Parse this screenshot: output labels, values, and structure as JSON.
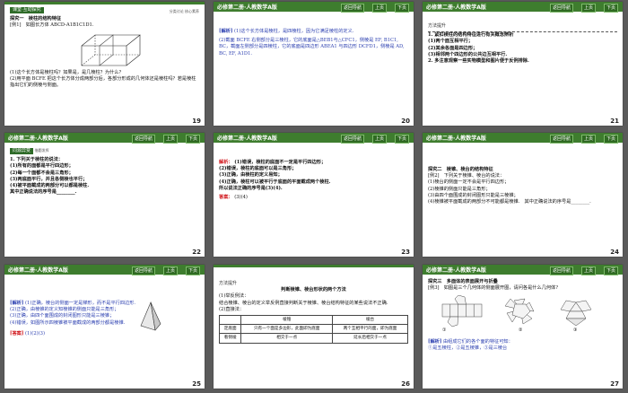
{
  "header": {
    "title": "必修第二册·人教数学A版",
    "nav_label": "返回导航",
    "prev_label": "上页",
    "next_label": "下页"
  },
  "slides": {
    "s19": {
      "page": "19",
      "section": "课堂·互动探究",
      "section_tag": "分类讨论  核心素养",
      "inquiry": "探究一　棱柱的结构特征",
      "example": "[例1]　如图长方体 ABCD-A1B1C1D1.",
      "q1": "(1)这个长方体是棱柱吗？如果是，是几棱柱？为什么？",
      "q2": "(2)用平面 BCFE 把这个长方体分成两部分后，各部分形成的几何体还是棱柱吗？若是棱柱指出它们的侧棱与侧面。"
    },
    "s20": {
      "page": "20",
      "tag": "[解析]",
      "text1": "(1)这个长方体是棱柱，是四棱柱，因为它满足棱柱的定义.",
      "text2": "(2)截面 BCFE 右侧部分是三棱柱，它的底面是△BEB1与△CFC1，侧棱是 EF, B1C1, BC，截面左侧部分是四棱柱，它的底面是四边形 ABEA1 与四边形 DCFD1，侧棱是 AD, BC, EF, A1D1."
    },
    "s21": {
      "page": "21",
      "method": "方法提升",
      "lead": "1. 紧扣棱柱的结构特征进行有关概念辨析",
      "l1": "(1)两个面互相平行；",
      "l2": "(2)其余各面是四边形；",
      "l3": "(3)相邻两个四边形的公共边互相平行.",
      "l4": "2. 多注意观察一些实物模型和图片便于反例排除."
    },
    "s22": {
      "page": "22",
      "section": "同源异变",
      "section_tag": "借题发挥",
      "lead": "1. 下列关于棱柱的说法：",
      "l1": "(1)所有的面都是平行四边形；",
      "l2": "(2)每一个面都不会是三角形；",
      "l3": "(3)两底面平行，并且各侧棱也平行；",
      "l4": "(4)被平面截成的两部分可以都是棱柱.",
      "ask": "其中正确说法的序号是________."
    },
    "s23": {
      "page": "23",
      "tag": "解析：",
      "t1": "(1)错误，棱柱的底面不一定是平行四边形；",
      "t2": "(2)错误，棱柱的底面可以是三角形；",
      "t3": "(3)正确，由棱柱的定义易知；",
      "t4": "(4)正确，棱柱可以被平行于底面的平面截成两个棱柱.",
      "t5": "所以说法正确的序号是(3)(4).",
      "ans_label": "答案：",
      "ans": "(3)(4)"
    },
    "s24": {
      "page": "24",
      "inquiry": "探究二　棱锥、棱台的结构特征",
      "example": "[例2]　下列关于棱锥、棱台的说法：",
      "l1": "(1)棱台的侧面一定不会是平行四边形；",
      "l2": "(2)棱锥的侧面只能是三角形；",
      "l3": "(3)由四个面围成的封闭图形只能是三棱锥；",
      "l4": "(4)棱锥被平面截成的两部分不可能都是棱锥.　其中正确说法的序号是________."
    },
    "s25": {
      "page": "25",
      "tag": "[解析]",
      "t1": "(1)正确，棱台的侧面一定是梯形，而不是平行四边形.",
      "t2": "(2)正确，由棱锥的定义知棱锥的侧面只能是三角形；",
      "t3": "(3)正确，由四个面围成的封闭图形只能是三棱锥；",
      "t4": "(4)错误，如图所示四棱锥被平面截成的两部分都是棱锥.",
      "ans_label": "[答案]",
      "ans": "(1)(2)(3)"
    },
    "s26": {
      "page": "26",
      "method": "方法提升",
      "title": "判断棱锥、棱台形状的两个方法",
      "l1": "(1)举反例法：",
      "l2": "结合棱锥、棱台的定义举反例直接判断关于棱锥、棱台结构特征的某些说法不正确.",
      "l3": "(2)直接法：",
      "th1": "棱锥",
      "th2": "棱台",
      "r1c0": "定底面",
      "r1c1": "只有一个面是多边形，此面即为底面",
      "r1c2": "两个互相平行的面，即为底面",
      "r2c0": "看侧棱",
      "r2c1": "相交于一点",
      "r2c2": "延长后相交于一点"
    },
    "s27": {
      "page": "27",
      "inquiry": "探究三　多面体的表面展开与折叠",
      "example": "[例3]　如图是三个几何体的侧面展开图，请问各是什么几何体?",
      "tag": "[解析]",
      "t1": "由组成它们的各个面的特征可知：",
      "c1": "①",
      "c2": "②",
      "c3": "③",
      "t2": "①是五棱柱，②是五棱锥，③是三棱台"
    }
  }
}
